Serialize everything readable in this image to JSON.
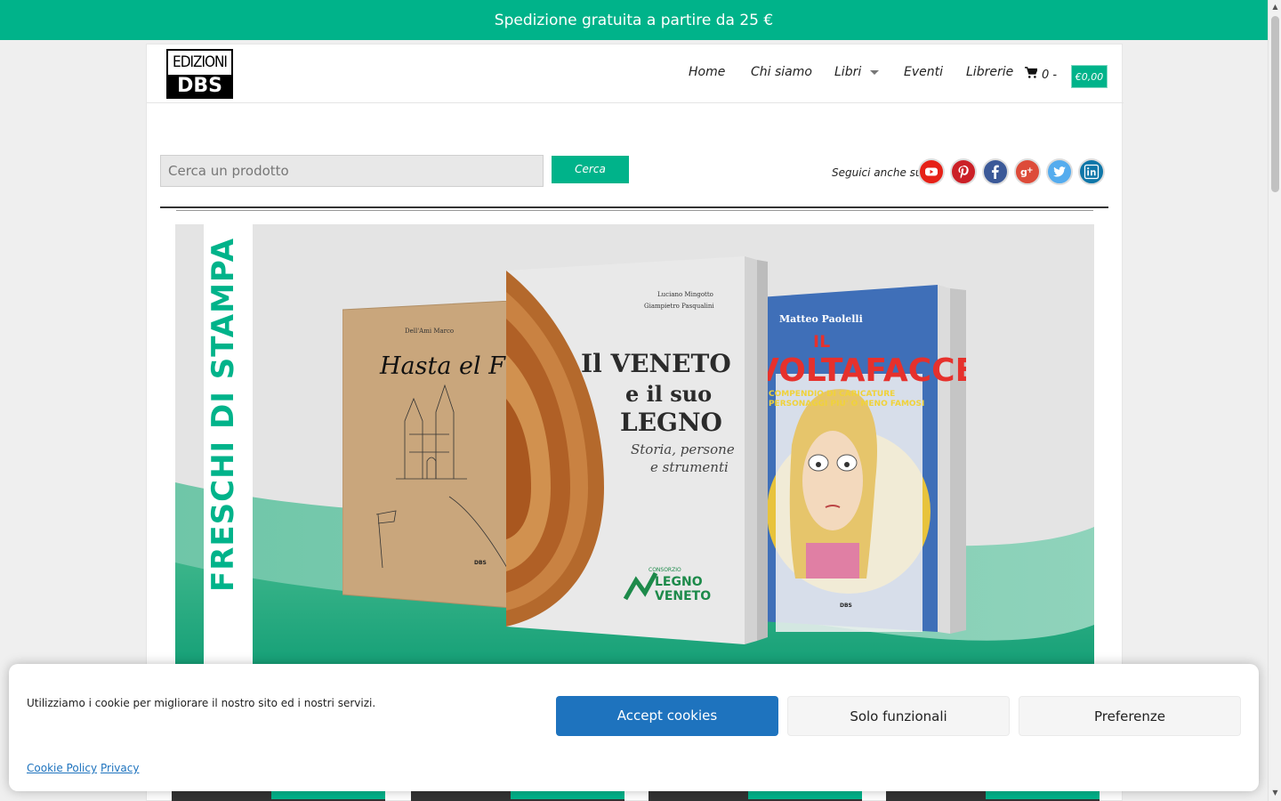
{
  "topbar": {
    "text": "Spedizione gratuita a partire da 25 €"
  },
  "logo": {
    "top": "EDIZIONI",
    "bottom": "DBS"
  },
  "nav": {
    "items": [
      "Home",
      "Chi siamo",
      "Libri",
      "Eventi",
      "Librerie"
    ],
    "cart_count": "0 -",
    "cart_total": "€0,00"
  },
  "search": {
    "placeholder": "Cerca un prodotto",
    "button": "Cerca"
  },
  "social": {
    "label": "Seguici anche su",
    "icons": [
      "youtube-icon",
      "pinterest-icon",
      "facebook-icon",
      "google-plus-icon",
      "twitter-icon",
      "linkedin-icon"
    ],
    "colors": {
      "youtube": "#e62117",
      "pinterest": "#cb2027",
      "facebook": "#3b5998",
      "google_plus": "#dd4b39",
      "twitter": "#55acee",
      "linkedin": "#0e76a8"
    }
  },
  "banner": {
    "vertical_text": "FRESCHI DI STAMPA",
    "book1": {
      "author": "Dell'Ami Marco",
      "title": "Hasta el Final"
    },
    "book2": {
      "authors": [
        "Luciano Mingotto",
        "Giampietro Pasqualini"
      ],
      "title_lines": [
        "Il VENETO",
        "e il suo",
        "LEGNO"
      ],
      "subtitle_lines": [
        "Storia, persone",
        "e strumenti"
      ],
      "brand_small": "CONSORZIO",
      "brand_lines": [
        "LEGNO",
        "VENETO"
      ]
    },
    "book3": {
      "author": "Matteo Paolelli",
      "title_lines": [
        "IL",
        "VOLTAFACCE"
      ],
      "subtitle_lines": [
        "COMPENDIO DI CARICATURE",
        "DI PERSONAGGI PIU' O MENO FAMOSI"
      ]
    },
    "colors": {
      "accent": "#00b38a"
    }
  },
  "cookie": {
    "message": "Utilizziamo i cookie per migliorare il nostro sito ed i nostri servizi.",
    "accept": "Accept cookies",
    "functional": "Solo funzionali",
    "preferences": "Preferenze",
    "policy_link": "Cookie Policy",
    "privacy_link": "Privacy"
  },
  "colors": {
    "brand": "#00b38a",
    "cookie_primary": "#1e73be"
  }
}
